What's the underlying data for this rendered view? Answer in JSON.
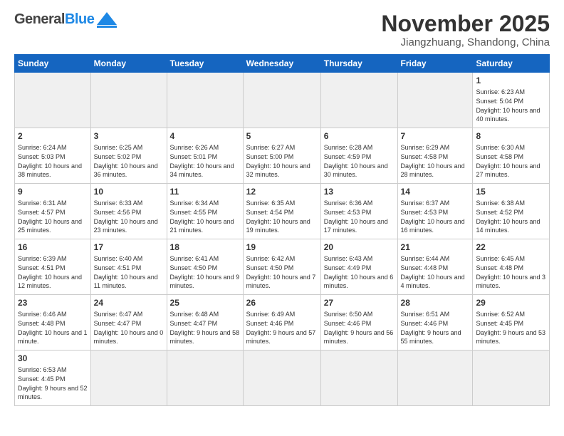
{
  "header": {
    "logo_general": "General",
    "logo_blue": "Blue",
    "month_title": "November 2025",
    "location": "Jiangzhuang, Shandong, China"
  },
  "weekdays": [
    "Sunday",
    "Monday",
    "Tuesday",
    "Wednesday",
    "Thursday",
    "Friday",
    "Saturday"
  ],
  "weeks": [
    [
      {
        "day": "",
        "info": ""
      },
      {
        "day": "",
        "info": ""
      },
      {
        "day": "",
        "info": ""
      },
      {
        "day": "",
        "info": ""
      },
      {
        "day": "",
        "info": ""
      },
      {
        "day": "",
        "info": ""
      },
      {
        "day": "1",
        "info": "Sunrise: 6:23 AM\nSunset: 5:04 PM\nDaylight: 10 hours and 40 minutes."
      }
    ],
    [
      {
        "day": "2",
        "info": "Sunrise: 6:24 AM\nSunset: 5:03 PM\nDaylight: 10 hours and 38 minutes."
      },
      {
        "day": "3",
        "info": "Sunrise: 6:25 AM\nSunset: 5:02 PM\nDaylight: 10 hours and 36 minutes."
      },
      {
        "day": "4",
        "info": "Sunrise: 6:26 AM\nSunset: 5:01 PM\nDaylight: 10 hours and 34 minutes."
      },
      {
        "day": "5",
        "info": "Sunrise: 6:27 AM\nSunset: 5:00 PM\nDaylight: 10 hours and 32 minutes."
      },
      {
        "day": "6",
        "info": "Sunrise: 6:28 AM\nSunset: 4:59 PM\nDaylight: 10 hours and 30 minutes."
      },
      {
        "day": "7",
        "info": "Sunrise: 6:29 AM\nSunset: 4:58 PM\nDaylight: 10 hours and 28 minutes."
      },
      {
        "day": "8",
        "info": "Sunrise: 6:30 AM\nSunset: 4:58 PM\nDaylight: 10 hours and 27 minutes."
      }
    ],
    [
      {
        "day": "9",
        "info": "Sunrise: 6:31 AM\nSunset: 4:57 PM\nDaylight: 10 hours and 25 minutes."
      },
      {
        "day": "10",
        "info": "Sunrise: 6:33 AM\nSunset: 4:56 PM\nDaylight: 10 hours and 23 minutes."
      },
      {
        "day": "11",
        "info": "Sunrise: 6:34 AM\nSunset: 4:55 PM\nDaylight: 10 hours and 21 minutes."
      },
      {
        "day": "12",
        "info": "Sunrise: 6:35 AM\nSunset: 4:54 PM\nDaylight: 10 hours and 19 minutes."
      },
      {
        "day": "13",
        "info": "Sunrise: 6:36 AM\nSunset: 4:53 PM\nDaylight: 10 hours and 17 minutes."
      },
      {
        "day": "14",
        "info": "Sunrise: 6:37 AM\nSunset: 4:53 PM\nDaylight: 10 hours and 16 minutes."
      },
      {
        "day": "15",
        "info": "Sunrise: 6:38 AM\nSunset: 4:52 PM\nDaylight: 10 hours and 14 minutes."
      }
    ],
    [
      {
        "day": "16",
        "info": "Sunrise: 6:39 AM\nSunset: 4:51 PM\nDaylight: 10 hours and 12 minutes."
      },
      {
        "day": "17",
        "info": "Sunrise: 6:40 AM\nSunset: 4:51 PM\nDaylight: 10 hours and 11 minutes."
      },
      {
        "day": "18",
        "info": "Sunrise: 6:41 AM\nSunset: 4:50 PM\nDaylight: 10 hours and 9 minutes."
      },
      {
        "day": "19",
        "info": "Sunrise: 6:42 AM\nSunset: 4:50 PM\nDaylight: 10 hours and 7 minutes."
      },
      {
        "day": "20",
        "info": "Sunrise: 6:43 AM\nSunset: 4:49 PM\nDaylight: 10 hours and 6 minutes."
      },
      {
        "day": "21",
        "info": "Sunrise: 6:44 AM\nSunset: 4:48 PM\nDaylight: 10 hours and 4 minutes."
      },
      {
        "day": "22",
        "info": "Sunrise: 6:45 AM\nSunset: 4:48 PM\nDaylight: 10 hours and 3 minutes."
      }
    ],
    [
      {
        "day": "23",
        "info": "Sunrise: 6:46 AM\nSunset: 4:48 PM\nDaylight: 10 hours and 1 minute."
      },
      {
        "day": "24",
        "info": "Sunrise: 6:47 AM\nSunset: 4:47 PM\nDaylight: 10 hours and 0 minutes."
      },
      {
        "day": "25",
        "info": "Sunrise: 6:48 AM\nSunset: 4:47 PM\nDaylight: 9 hours and 58 minutes."
      },
      {
        "day": "26",
        "info": "Sunrise: 6:49 AM\nSunset: 4:46 PM\nDaylight: 9 hours and 57 minutes."
      },
      {
        "day": "27",
        "info": "Sunrise: 6:50 AM\nSunset: 4:46 PM\nDaylight: 9 hours and 56 minutes."
      },
      {
        "day": "28",
        "info": "Sunrise: 6:51 AM\nSunset: 4:46 PM\nDaylight: 9 hours and 55 minutes."
      },
      {
        "day": "29",
        "info": "Sunrise: 6:52 AM\nSunset: 4:45 PM\nDaylight: 9 hours and 53 minutes."
      }
    ],
    [
      {
        "day": "30",
        "info": "Sunrise: 6:53 AM\nSunset: 4:45 PM\nDaylight: 9 hours and 52 minutes."
      },
      {
        "day": "",
        "info": ""
      },
      {
        "day": "",
        "info": ""
      },
      {
        "day": "",
        "info": ""
      },
      {
        "day": "",
        "info": ""
      },
      {
        "day": "",
        "info": ""
      },
      {
        "day": "",
        "info": ""
      }
    ]
  ]
}
